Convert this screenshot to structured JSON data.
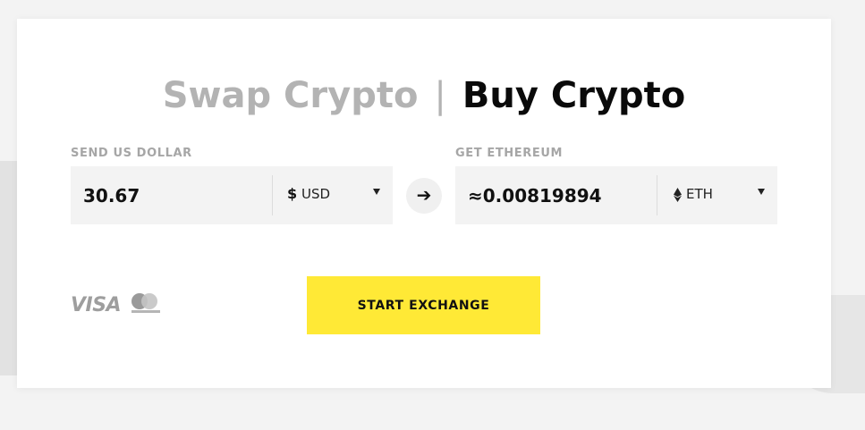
{
  "tabs": {
    "swap_label": "Swap Crypto",
    "separator": "|",
    "buy_label": "Buy Crypto"
  },
  "send": {
    "label": "SEND US DOLLAR",
    "amount": "30.67",
    "currency_symbol": "$",
    "currency_code": "USD"
  },
  "get": {
    "label": "GET ETHEREUM",
    "amount": "≈0.00819894",
    "currency_code": "ETH",
    "currency_icon": "ethereum-icon"
  },
  "arrow": "➔",
  "payment_methods": {
    "visa": "VISA",
    "mastercard_icon": "mastercard-icon"
  },
  "cta": {
    "label": "START EXCHANGE",
    "color": "#ffe936"
  }
}
